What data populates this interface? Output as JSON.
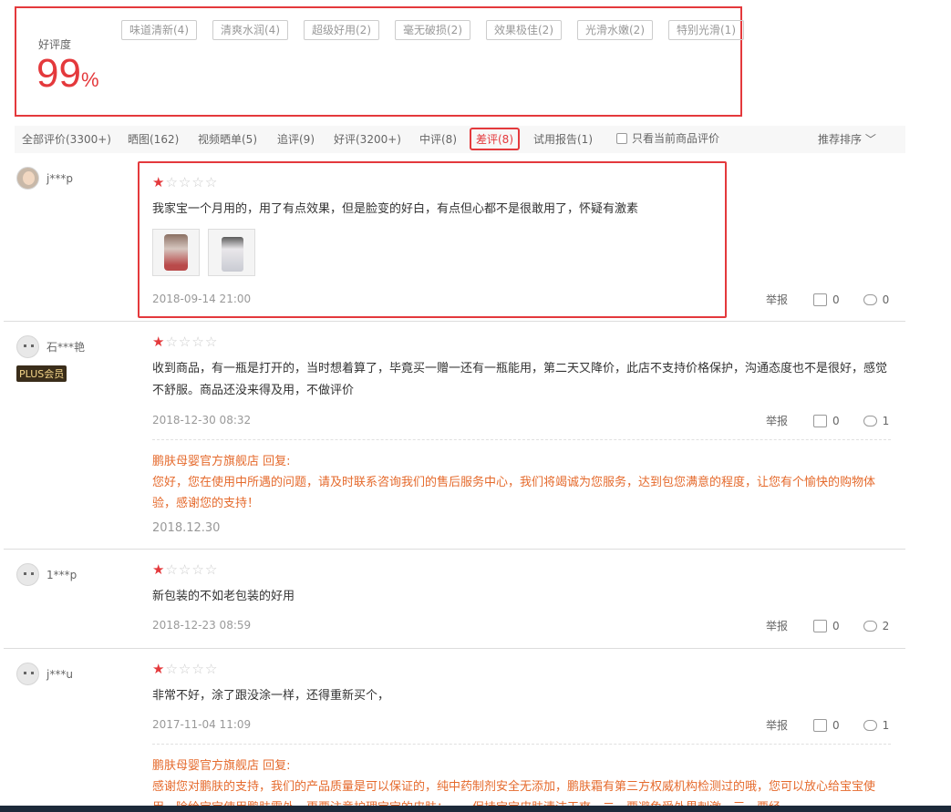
{
  "summary": {
    "rate_label": "好评度",
    "rate_value": "99",
    "rate_unit": "%",
    "tags": [
      "味道清新(4)",
      "清爽水润(4)",
      "超级好用(2)",
      "毫无破损(2)",
      "效果极佳(2)",
      "光滑水嫩(2)",
      "特别光滑(1)"
    ]
  },
  "filters": {
    "items": [
      "全部评价(3300+)",
      "晒图(162)",
      "视频晒单(5)",
      "追评(9)",
      "好评(3200+)",
      "中评(8)",
      "差评(8)",
      "试用报告(1)"
    ],
    "active": "差评(8)",
    "only_current": "只看当前商品评价",
    "sort": "推荐排序"
  },
  "review_ops": {
    "report": "举报"
  },
  "reviews": [
    {
      "user": "j***p",
      "stars": 1,
      "content": "我家宝一个月用的，用了有点效果，但是脸变的好白，有点但心都不是很敢用了，怀疑有激素",
      "date": "2018-09-14 21:00",
      "likes": "0",
      "replies": "0"
    },
    {
      "user": "石***艳",
      "badge": "PLUS会员",
      "stars": 1,
      "content": "收到商品，有一瓶是打开的，当时想着算了，毕竟买一赠一还有一瓶能用，第二天又降价，此店不支持价格保护，沟通态度也不是很好，感觉不舒服。商品还没来得及用，不做评价",
      "date": "2018-12-30 08:32",
      "likes": "0",
      "replies": "1",
      "reply_title": "鹏肤母婴官方旗舰店 回复:",
      "reply_text": "您好，您在使用中所遇的问题，请及时联系咨询我们的售后服务中心，我们将竭诚为您服务，达到包您满意的程度，让您有个愉快的购物体验，感谢您的支持！",
      "reply_date": "2018.12.30"
    },
    {
      "user": "1***p",
      "stars": 1,
      "content": "新包装的不如老包装的好用",
      "date": "2018-12-23 08:59",
      "likes": "0",
      "replies": "2"
    },
    {
      "user": "j***u",
      "stars": 1,
      "content": "非常不好，涂了跟没涂一样，还得重新买个，",
      "date": "2017-11-04 11:09",
      "likes": "0",
      "replies": "1",
      "reply_title": "鹏肤母婴官方旗舰店 回复:",
      "reply_text": "感谢您对鹏肤的支持，我们的产品质量是可以保证的，纯中药制剂安全无添加，鹏肤霜有第三方权威机构检测过的哦，您可以放心给宝宝使用，除给宝宝使用鹏肤霜外，更要注意护理宝宝的皮肤：一、保持宝宝皮肤清洁干爽，二、要避免受外界刺激，三、要经"
    }
  ]
}
